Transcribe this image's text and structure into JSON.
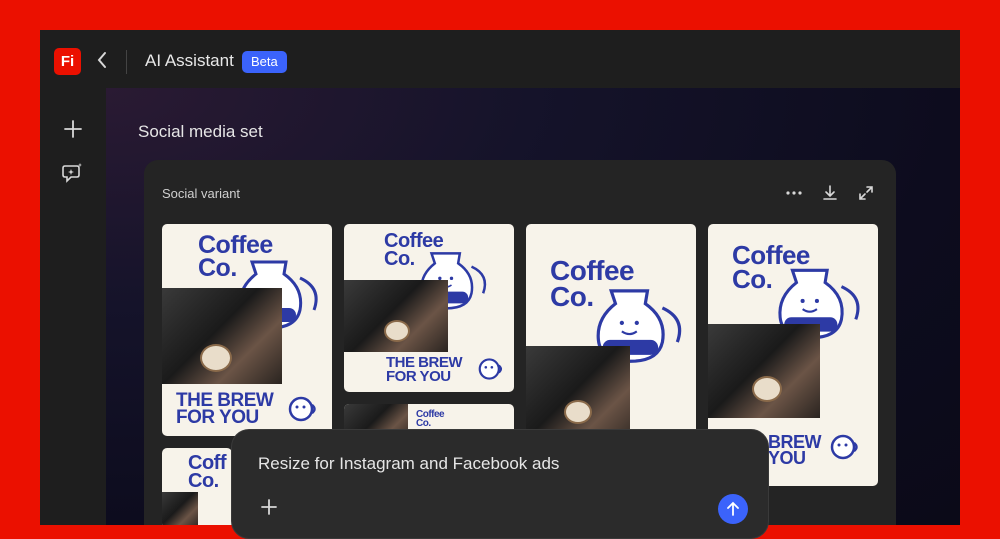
{
  "header": {
    "app_logo": "Fi",
    "title": "AI Assistant",
    "badge": "Beta"
  },
  "sidebar": {
    "items": [
      {
        "icon": "plus-icon"
      },
      {
        "icon": "chat-sparkle-icon"
      }
    ]
  },
  "main": {
    "section_title": "Social media set",
    "card": {
      "title": "Social variant",
      "actions": [
        "more-icon",
        "download-icon",
        "expand-icon"
      ]
    },
    "tiles": [
      {
        "headline": "Coffee\nCo.",
        "tagline": "THE BREW\nFOR YOU"
      },
      {
        "headline": "Coffee\nCo.",
        "tagline": "THE BREW\nFOR YOU"
      },
      {
        "headline": "Coffee\nCo."
      },
      {
        "headline": "Coffee\nCo.",
        "tagline": "BREW\nYOU"
      },
      {
        "headline": "Coffee\nCo."
      },
      {
        "headline": "Coff\nCo."
      }
    ]
  },
  "composer": {
    "text": "Resize for Instagram and Facebook ads"
  },
  "colors": {
    "accent": "#3b63fb",
    "brand_red": "#eb1000",
    "tile_ink": "#2d3aa5"
  }
}
